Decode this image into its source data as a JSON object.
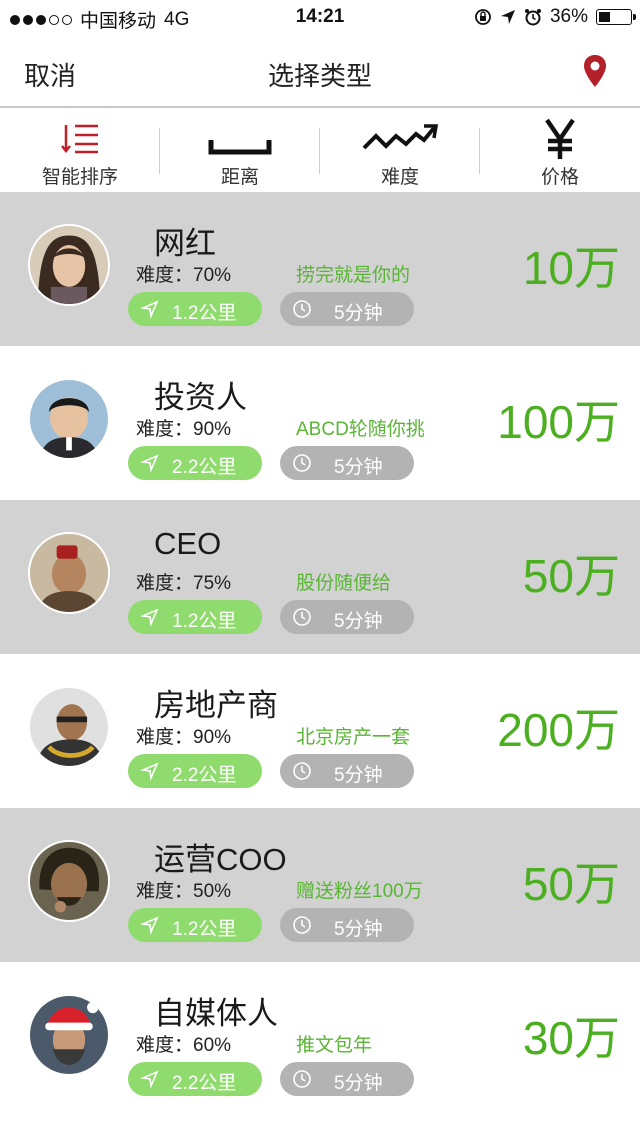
{
  "status_bar": {
    "carrier": "中国移动",
    "network": "4G",
    "time": "14:21",
    "battery_percent": "36%",
    "battery_level": 0.36,
    "signal_dots_filled": 3,
    "signal_dots_total": 5
  },
  "nav": {
    "cancel_label": "取消",
    "title": "选择类型",
    "location_icon": "location-pin-icon",
    "accent_color": "#b3202a"
  },
  "sort_tabs": [
    {
      "label": "智能排序",
      "icon": "sort-list-icon"
    },
    {
      "label": "距离",
      "icon": "distance-bracket-icon"
    },
    {
      "label": "难度",
      "icon": "trend-up-icon"
    },
    {
      "label": "价格",
      "icon": "yen-icon"
    }
  ],
  "colors": {
    "price_green": "#4caf20",
    "perk_green": "#5ab535",
    "distance_pill": "#8fdb6e",
    "time_pill": "#b3b3b3",
    "row_gray": "#d2d2d2"
  },
  "items": [
    {
      "name": "网红",
      "difficulty": "难度：70%",
      "perk": "捞完就是你的",
      "price": "10万",
      "distance": "1.2公里",
      "time": "5分钟"
    },
    {
      "name": "投资人",
      "difficulty": "难度：90%",
      "perk": "ABCD轮随你挑",
      "price": "100万",
      "distance": "2.2公里",
      "time": "5分钟"
    },
    {
      "name": "CEO",
      "difficulty": "难度：75%",
      "perk": "股份随便给",
      "price": "50万",
      "distance": "1.2公里",
      "time": "5分钟"
    },
    {
      "name": "房地产商",
      "difficulty": "难度：90%",
      "perk": "北京房产一套",
      "price": "200万",
      "distance": "2.2公里",
      "time": "5分钟"
    },
    {
      "name": "运营COO",
      "difficulty": "难度：50%",
      "perk": "赠送粉丝100万",
      "price": "50万",
      "distance": "1.2公里",
      "time": "5分钟"
    },
    {
      "name": "自媒体人",
      "difficulty": "难度：60%",
      "perk": "推文包年",
      "price": "30万",
      "distance": "2.2公里",
      "time": "5分钟"
    }
  ]
}
